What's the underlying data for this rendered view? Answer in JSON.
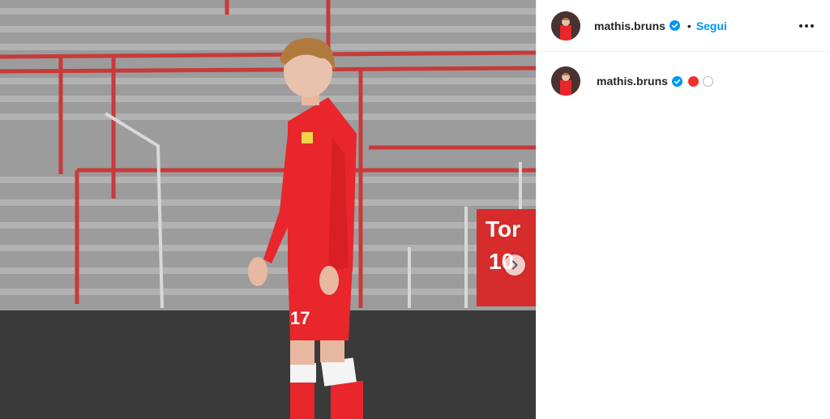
{
  "post": {
    "photo_alt_icon": "football-player-photo",
    "photo_sign_text": "Tor",
    "photo_sign_number": "10",
    "jersey_number": "17",
    "next_icon": "chevron-right-icon"
  },
  "header": {
    "username": "mathis.bruns",
    "verified_icon": "verified-badge-icon",
    "separator": "•",
    "follow_label": "Segui",
    "more_icon": "more-options-icon"
  },
  "caption": {
    "username": "mathis.bruns",
    "emoji_colors": [
      "#f0302a",
      "#ffffff"
    ]
  },
  "colors": {
    "accent": "#0095f6",
    "kit_red": "#e8262b"
  }
}
